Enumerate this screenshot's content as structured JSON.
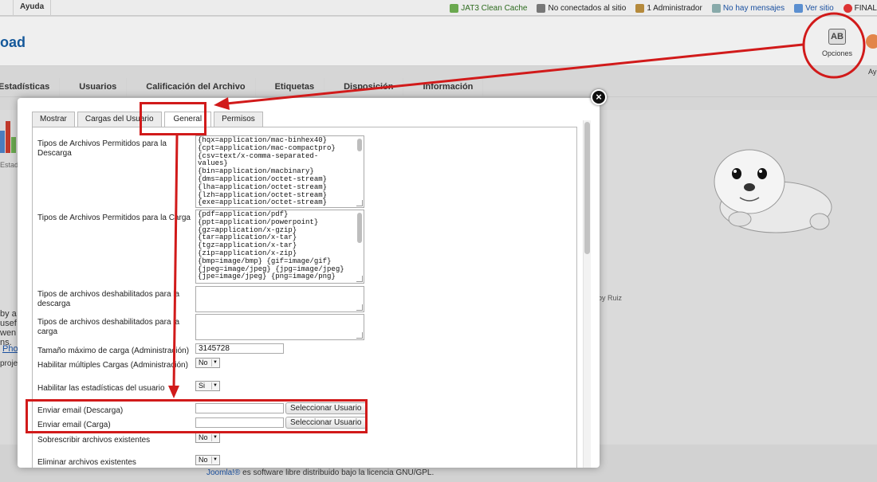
{
  "topbar": {
    "menu": [
      "Ayuda"
    ],
    "status": [
      {
        "label": "JAT3 Clean Cache",
        "icon": "cache-icon"
      },
      {
        "label": "No conectados al sitio",
        "icon": "users-icon"
      },
      {
        "label": "1 Administrador",
        "icon": "admin-icon"
      },
      {
        "label": "No hay mensajes",
        "icon": "messages-icon"
      },
      {
        "label": "Ver sitio",
        "icon": "view-site-icon"
      },
      {
        "label": "FINAL",
        "icon": "logout-icon"
      }
    ]
  },
  "header": {
    "title": "oad",
    "opciones": {
      "label": "Opciones",
      "icon_text": "AB"
    },
    "ayuda_label": "Ay"
  },
  "subnav": [
    "Estadísticas",
    "Usuarios",
    "Calificación del Archivo",
    "Etiquetas",
    "Disposición",
    "Información"
  ],
  "background": {
    "left_text": "Estadís",
    "left_body": "by a\nusef\nwen\nns.",
    "left_link": "Pho",
    "left_proj": "projec",
    "byruiz": "oy Ruiz",
    "footer_link": "Joomla!®",
    "footer_text": " es software libre distribuido bajo la licencia GNU/GPL."
  },
  "modal": {
    "close_icon": "×",
    "tabs": [
      {
        "label": "Mostrar",
        "active": false
      },
      {
        "label": "Cargas del Usuario",
        "active": false
      },
      {
        "label": "General",
        "active": true
      },
      {
        "label": "Permisos",
        "active": false
      }
    ],
    "fields": {
      "download_types": {
        "label": "Tipos de Archivos Permitidos para la Descarga",
        "value": "{hqx=application/mac-binhex40}\n{cpt=application/mac-compactpro}\n{csv=text/x-comma-separated-\nvalues}\n{bin=application/macbinary}\n{dms=application/octet-stream}\n{lha=application/octet-stream}\n{lzh=application/octet-stream}\n{exe=application/octet-stream}"
      },
      "upload_types": {
        "label": "Tipos de Archivos Permitidos para la Carga",
        "value": "{pdf=application/pdf}\n{ppt=application/powerpoint}\n{gz=application/x-gzip}\n{tar=application/x-tar}\n{tgz=application/x-tar}\n{zip=application/x-zip}\n{bmp=image/bmp} {gif=image/gif}\n{jpeg=image/jpeg} {jpg=image/jpeg}\n{jpe=image/jpeg} {png=image/png}"
      },
      "disabled_download": {
        "label": "Tipos de archivos deshabilitados para la descarga",
        "value": ""
      },
      "disabled_upload": {
        "label": "Tipos de archivos deshabilitados para la carga",
        "value": ""
      },
      "max_upload": {
        "label": "Tamaño máximo de carga (Administración)",
        "value": "3145728"
      },
      "multi_upload": {
        "label": "Habilitar múltiples Cargas (Administración)",
        "value": "No"
      },
      "user_stats": {
        "label": "Habilitar las estadísticas del usuario",
        "value": "Si"
      },
      "email_download": {
        "label": "Enviar email (Descarga)",
        "value": "",
        "button": "Seleccionar Usuario"
      },
      "email_upload": {
        "label": "Enviar email (Carga)",
        "value": "",
        "button": "Seleccionar Usuario"
      },
      "overwrite": {
        "label": "Sobrescribir archivos existentes",
        "value": "No"
      },
      "delete_existing": {
        "label": "Eliminar archivos existentes",
        "value": "No"
      }
    }
  },
  "colors": {
    "annotation": "#d11a1a",
    "link": "#1a50a0",
    "title": "#14589a"
  }
}
